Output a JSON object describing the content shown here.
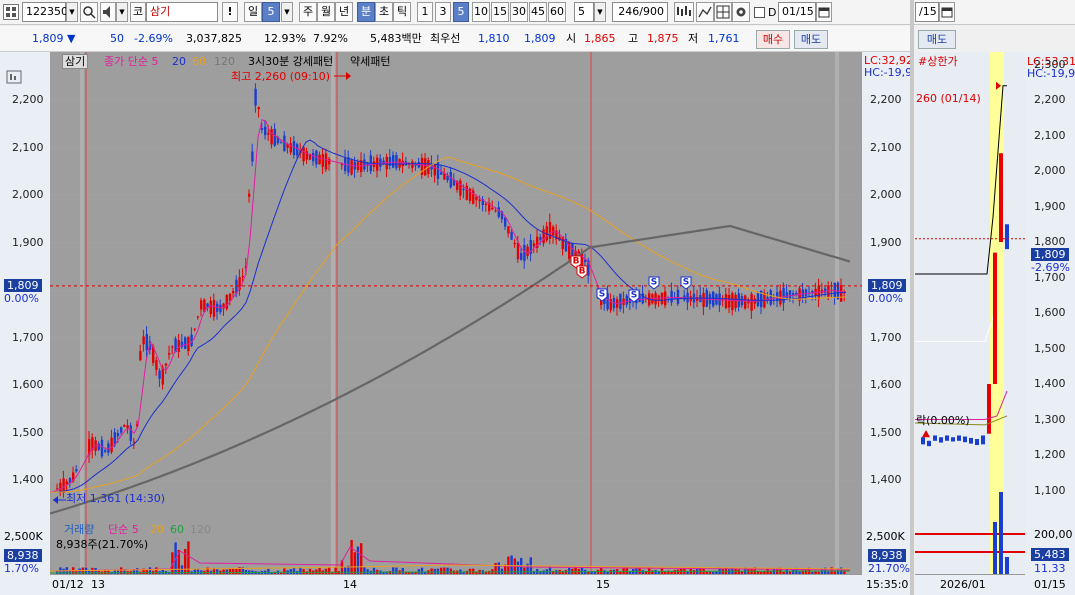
{
  "toolbar": {
    "code": "122350",
    "market_prefix": "코",
    "stock_name": "삼기",
    "warning_label": "!",
    "period_buttons": [
      "일",
      "5"
    ],
    "period_tabs": [
      "주",
      "월",
      "년",
      "분",
      "초",
      "틱"
    ],
    "minute_buttons": [
      "1",
      "3",
      "5",
      "10",
      "15",
      "30",
      "45",
      "60"
    ],
    "selected_minute": "5",
    "interval_value": "5",
    "bar_count": "246/900",
    "date_label": "D",
    "date_value": "01/15",
    "right_date_value": "/15"
  },
  "quote": {
    "price": "1,809 ▼",
    "change": "50",
    "change_rate": "-2.69%",
    "volume": "3,037,825",
    "turnover_rate": "12.93%",
    "vol_ratio": "7.92%",
    "amount": "5,483백만",
    "best_label": "최우선",
    "best_ask": "1,810",
    "best_bid": "1,809",
    "open_label": "시",
    "open": "1,865",
    "high_label": "고",
    "high": "1,875",
    "low_label": "저",
    "low": "1,761",
    "buy_label": "매수",
    "sell_label": "매도",
    "sell_label_right": "매도"
  },
  "main_chart": {
    "stock_tag": "삼기",
    "ma_legend": [
      {
        "label": "종가 단순 5",
        "color": "#e01fa0"
      },
      {
        "label": "20",
        "color": "#1a2fd0"
      },
      {
        "label": "60",
        "color": "#e8a020"
      },
      {
        "label": "120",
        "color": "#777777"
      }
    ],
    "pattern_text": "3시30분 강세패턴",
    "pattern_text2": "약세패턴",
    "high_annot": "최고 2,260 (09:10)",
    "low_annot": "최저 1,361 (14:30)",
    "lc_label": "LC:32,92",
    "hc_label": "HC:-19,9",
    "current_price_box": "1,809",
    "current_pct": "0.00%",
    "y_ticks": [
      "2,200",
      "2,100",
      "2,000",
      "1,900",
      "1,800",
      "1,700",
      "1,600",
      "1,500",
      "1,400"
    ]
  },
  "volume_chart": {
    "legend": [
      {
        "label": "거래량",
        "color": "#2060c0"
      },
      {
        "label": "단순 5",
        "color": "#e01fa0"
      },
      {
        "label": "20",
        "color": "#e8a020"
      },
      {
        "label": "60",
        "color": "#20a040"
      },
      {
        "label": "120",
        "color": "#888888"
      }
    ],
    "info": "8,938주(21.70%)",
    "y_top": "2,500K",
    "cur_box": "8,938",
    "pct": "1.70%",
    "pct_right": "21.70%"
  },
  "x_axis": {
    "labels": [
      "01/12",
      "13",
      "14",
      "15"
    ],
    "time_label": "15:35:0"
  },
  "side_chart": {
    "title": "#상한가",
    "lc_label": "LC:53,31",
    "hc_label": "HC:-19,9",
    "high_annot": "260 (01/14)",
    "low_annot": "락(0.00%)",
    "cur_box": "1,809",
    "cur_pct": "-2.69%",
    "y_ticks": [
      "2,300",
      "2,200",
      "2,100",
      "2,000",
      "1,900",
      "1,800",
      "1,700",
      "1,600",
      "1,500",
      "1,400",
      "1,300",
      "1,200",
      "1,100"
    ],
    "vol_top": "200,00",
    "vol_box": "5,483",
    "vol_pct": "11.33",
    "x_labels": [
      "2026/01",
      "01/15"
    ]
  },
  "colors": {
    "up": "#e60000",
    "down": "#1a3fd0",
    "ma5": "#e01fa0",
    "ma20": "#1a2fd0",
    "ma60": "#e8a020",
    "ma120": "#666666",
    "plot_bg": "#9e9e9e",
    "highlight": "#ffff99"
  },
  "icons": [
    "search-icon",
    "speaker-icon",
    "dropdown-icon",
    "settings-icon",
    "chart-tool-icon",
    "calendar-icon",
    "grid-icon"
  ]
}
